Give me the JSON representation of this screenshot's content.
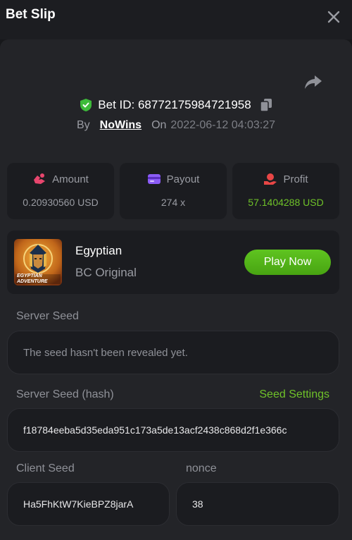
{
  "header": {
    "title": "Bet Slip"
  },
  "bet": {
    "id_label": "Bet ID: 68772175984721958",
    "by_label": "By",
    "user": "NoWins",
    "on_label": "On",
    "date": "2022-06-12 04:03:27"
  },
  "stats": [
    {
      "label": "Amount",
      "value": "0.20930560 USD",
      "icon": "amount-icon"
    },
    {
      "label": "Payout",
      "value": "274 x",
      "icon": "card-icon"
    },
    {
      "label": "Profit",
      "value": "57.1404288 USD",
      "icon": "profit-icon"
    }
  ],
  "game": {
    "name": "Egyptian",
    "provider": "BC Original",
    "thumb_text": "EGYPTIAN ADVENTURE",
    "play_label": "Play Now"
  },
  "server_seed": {
    "label": "Server Seed",
    "value": "The seed hasn't been revealed yet."
  },
  "server_seed_hash": {
    "label": "Server Seed (hash)",
    "settings_label": "Seed Settings",
    "value": "f18784eeba5d35eda951c173a5de13acf2438c868d2f1e366c"
  },
  "client_seed": {
    "label": "Client Seed",
    "value": "Ha5FhKtW7KieBPZ8jarA"
  },
  "nonce": {
    "label": "nonce",
    "value": "38"
  },
  "colors": {
    "accent_green": "#6fc229",
    "shield_green": "#3dbb3a",
    "amount_pink": "#e8466e",
    "payout_purple": "#8b5cf6",
    "profit_red": "#e84646"
  }
}
